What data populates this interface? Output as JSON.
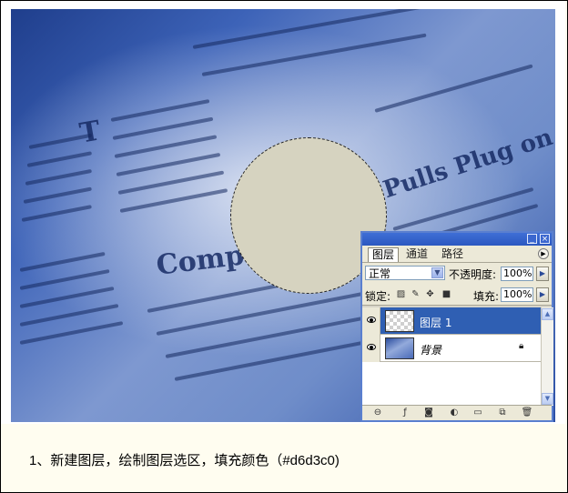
{
  "layers_panel": {
    "tabs": [
      {
        "label": "图层",
        "active": true
      },
      {
        "label": "通道",
        "active": false
      },
      {
        "label": "路径",
        "active": false
      }
    ],
    "blend_mode": "正常",
    "opacity_label": "不透明度:",
    "opacity_value": "100%",
    "lock_label": "锁定:",
    "fill_label": "填充:",
    "fill_value": "100%",
    "layers": [
      {
        "name": "图层 1",
        "visible": true,
        "selected": true,
        "thumbnail": "transparent"
      },
      {
        "name": "背景",
        "visible": true,
        "selected": false,
        "thumbnail": "photo",
        "locked": true
      }
    ],
    "footer_icons": [
      "link-icon",
      "layer-style-icon",
      "layer-mask-icon",
      "adjustment-layer-icon",
      "new-group-icon",
      "new-layer-icon",
      "trash-icon"
    ]
  },
  "canvas": {
    "selection_fill_color": "#d6d3c0"
  },
  "caption": {
    "text": "1、新建图层，绘制图层选区，填充颜色（#d6d3c0)"
  }
}
